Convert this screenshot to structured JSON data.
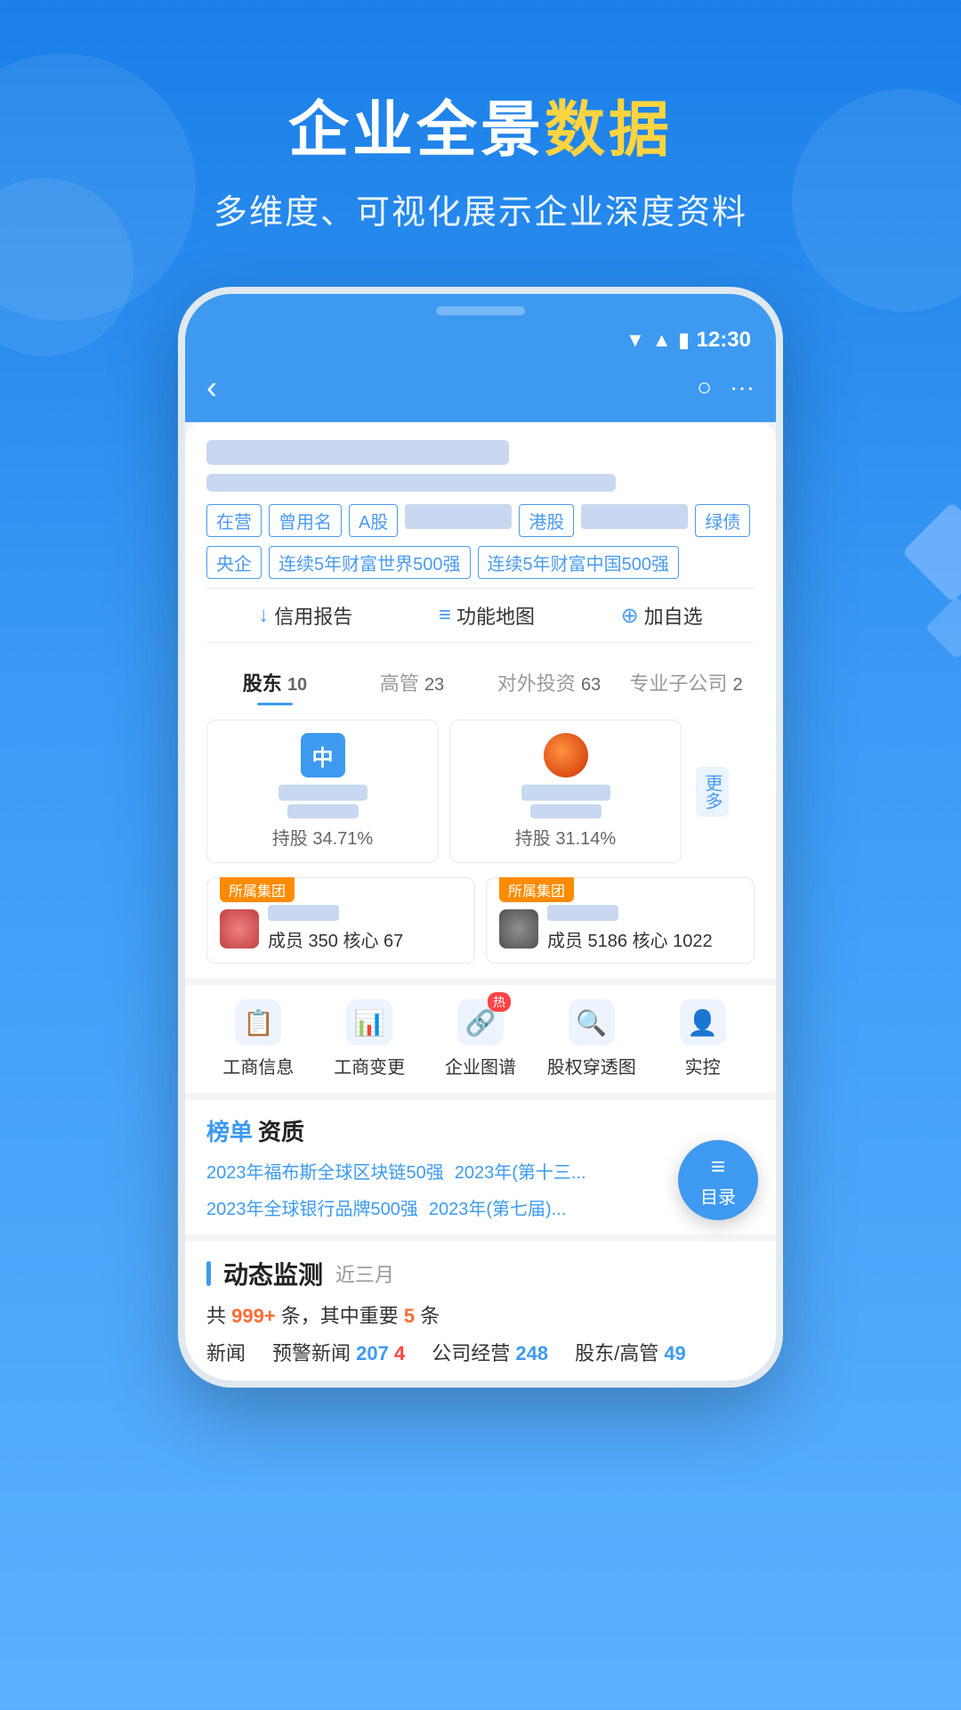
{
  "hero": {
    "title_part1": "企业全景",
    "title_part2": "数据",
    "subtitle": "多维度、可视化展示企业深度资料"
  },
  "status_bar": {
    "time": "12:30"
  },
  "company": {
    "tags": [
      "在营",
      "曾用名",
      "A股",
      "港股",
      "绿债",
      "央企",
      "连续5年财富世界500强",
      "连续5年财富中国500强"
    ],
    "actions": [
      "信用报告",
      "功能地图",
      "加自选"
    ]
  },
  "tabs": [
    {
      "label": "股东",
      "count": "10"
    },
    {
      "label": "高管",
      "count": "23"
    },
    {
      "label": "对外投资",
      "count": "63"
    },
    {
      "label": "专业子公司",
      "count": "2"
    }
  ],
  "shareholders": [
    {
      "avatar_text": "中",
      "percent": "持股 34.71%"
    },
    {
      "avatar_text": "🔴",
      "percent": "持股 31.14%"
    },
    {
      "more_text": "更多"
    }
  ],
  "groups": [
    {
      "badge": "所属集团",
      "logo_color": "pink",
      "stats": "成员 350  核心 67"
    },
    {
      "badge": "所属集团",
      "logo_color": "gray",
      "stats": "成员 5186  核心 1022"
    }
  ],
  "features": [
    {
      "icon": "📋",
      "label": "工商信息",
      "hot": false
    },
    {
      "icon": "📊",
      "label": "工商变更",
      "hot": false
    },
    {
      "icon": "🔗",
      "label": "企业图谱",
      "hot": true
    },
    {
      "icon": "🔍",
      "label": "股权穿透图",
      "hot": false
    },
    {
      "icon": "👤",
      "label": "实控",
      "hot": false
    }
  ],
  "rankings": {
    "title_blue": "榜单",
    "title": "资质",
    "links": [
      "2023年福布斯全球区块链50强",
      "2023年(第十三...",
      "2023年全球银行品牌500强",
      "2023年(第七届)..."
    ]
  },
  "monitor": {
    "title": "动态监测",
    "period": "近三月",
    "total": "999+",
    "important": "5",
    "stats": [
      {
        "label": "新闻",
        "value": ""
      },
      {
        "label": "预警新闻",
        "value": "207",
        "extra": "4"
      },
      {
        "label": "公司经营",
        "value": "248"
      },
      {
        "label": "股东/高管",
        "value": "49"
      }
    ]
  },
  "fab": {
    "label": "目录"
  }
}
